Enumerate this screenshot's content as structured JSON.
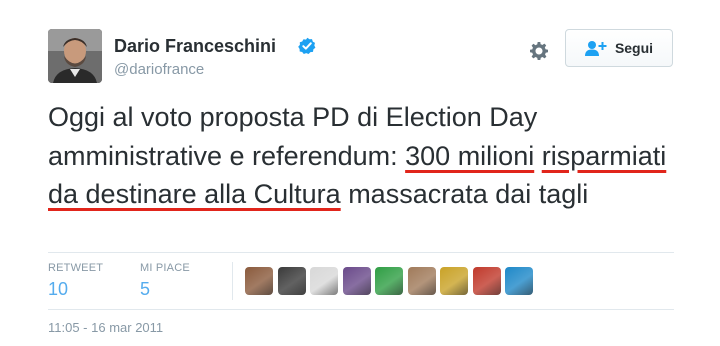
{
  "user": {
    "display_name": "Dario Franceschini",
    "handle": "@dariofrance",
    "verified": true
  },
  "actions": {
    "settings_icon": "gear-icon",
    "follow_label": "Segui",
    "follow_icon": "add-user-icon"
  },
  "tweet": {
    "text_plain_1": "Oggi al voto proposta PD di Election Day amministrative e referendum: ",
    "text_underlined_1": "300 milioni",
    "text_plain_2": " ",
    "text_underlined_2": "risparmiati da destinare alla Cultura",
    "text_plain_3": " massacrata dai tagli"
  },
  "stats": {
    "retweets_label": "RETWEET",
    "retweets_count": "10",
    "likes_label": "MI PIACE",
    "likes_count": "5"
  },
  "likers": [
    {
      "name": "liker-avatar-1",
      "color": "#8a5a3c"
    },
    {
      "name": "liker-avatar-2",
      "color": "#3a3a3a"
    },
    {
      "name": "liker-avatar-3",
      "color": "#d8d8d8"
    },
    {
      "name": "liker-avatar-4",
      "color": "#6a4a8a"
    },
    {
      "name": "liker-avatar-5",
      "color": "#2f9e44"
    },
    {
      "name": "liker-avatar-6",
      "color": "#a07a5a"
    },
    {
      "name": "liker-avatar-7",
      "color": "#c9a227"
    },
    {
      "name": "liker-avatar-8",
      "color": "#c0392b"
    },
    {
      "name": "liker-avatar-9",
      "color": "#1e88c8"
    }
  ],
  "timestamp": "11:05 - 16 mar 2011",
  "colors": {
    "accent": "#55acee",
    "verified": "#1da1f2",
    "underline": "#e1251b",
    "muted": "#8899a6"
  }
}
